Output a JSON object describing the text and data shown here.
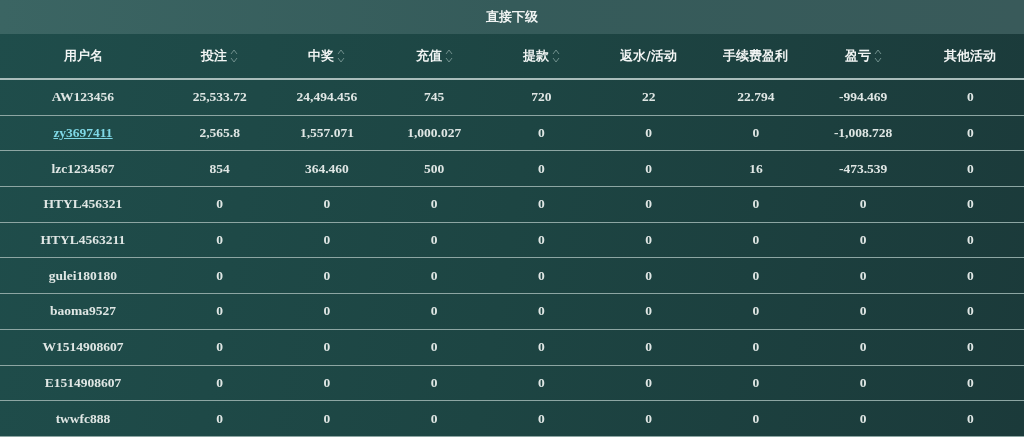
{
  "title": "直接下级",
  "columns": [
    {
      "label": "用户名",
      "sortable": false
    },
    {
      "label": "投注",
      "sortable": true
    },
    {
      "label": "中奖",
      "sortable": true
    },
    {
      "label": "充值",
      "sortable": true
    },
    {
      "label": "提款",
      "sortable": true
    },
    {
      "label": "返水/活动",
      "sortable": false
    },
    {
      "label": "手续费盈利",
      "sortable": false
    },
    {
      "label": "盈亏",
      "sortable": true
    },
    {
      "label": "其他活动",
      "sortable": false
    }
  ],
  "rows": [
    {
      "user": "AW123456",
      "link": false,
      "cells": [
        "25,533.72",
        "24,494.456",
        "745",
        "720",
        "22",
        "22.794",
        "-994.469",
        "0"
      ]
    },
    {
      "user": "zy3697411",
      "link": true,
      "cells": [
        "2,565.8",
        "1,557.071",
        "1,000.027",
        "0",
        "0",
        "0",
        "-1,008.728",
        "0"
      ]
    },
    {
      "user": "lzc1234567",
      "link": false,
      "cells": [
        "854",
        "364.460",
        "500",
        "0",
        "0",
        "16",
        "-473.539",
        "0"
      ]
    },
    {
      "user": "HTYL456321",
      "link": false,
      "cells": [
        "0",
        "0",
        "0",
        "0",
        "0",
        "0",
        "0",
        "0"
      ]
    },
    {
      "user": "HTYL4563211",
      "link": false,
      "cells": [
        "0",
        "0",
        "0",
        "0",
        "0",
        "0",
        "0",
        "0"
      ]
    },
    {
      "user": "gulei180180",
      "link": false,
      "cells": [
        "0",
        "0",
        "0",
        "0",
        "0",
        "0",
        "0",
        "0"
      ]
    },
    {
      "user": "baoma9527",
      "link": false,
      "cells": [
        "0",
        "0",
        "0",
        "0",
        "0",
        "0",
        "0",
        "0"
      ]
    },
    {
      "user": "W1514908607",
      "link": false,
      "cells": [
        "0",
        "0",
        "0",
        "0",
        "0",
        "0",
        "0",
        "0"
      ]
    },
    {
      "user": "E1514908607",
      "link": false,
      "cells": [
        "0",
        "0",
        "0",
        "0",
        "0",
        "0",
        "0",
        "0"
      ]
    },
    {
      "user": "twwfc888",
      "link": false,
      "cells": [
        "0",
        "0",
        "0",
        "0",
        "0",
        "0",
        "0",
        "0"
      ]
    }
  ]
}
